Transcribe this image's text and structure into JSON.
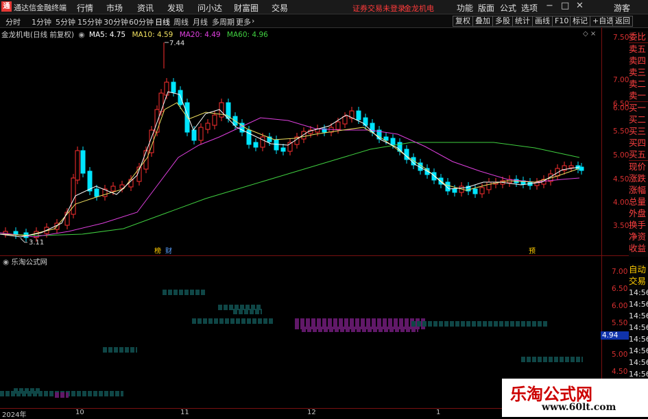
{
  "title_bar": {
    "app_title": "通达信金融终端",
    "menu": [
      "行情",
      "市场",
      "资讯",
      "发现",
      "问小达",
      "财富圈",
      "交易"
    ],
    "warning": "证券交易未登录",
    "stock_name": "金龙机电",
    "right_menu": [
      "功能",
      "版面",
      "公式",
      "选项"
    ],
    "guest": "游客"
  },
  "toolbar": {
    "periods": [
      "分时",
      "1分钟",
      "5分钟",
      "15分钟",
      "30分钟",
      "60分钟",
      "日线",
      "周线",
      "月线",
      "多周期",
      "更多"
    ],
    "active_period": "日线",
    "right_buttons": [
      "复权",
      "叠加",
      "多股",
      "统计",
      "画线",
      "F10",
      "标记",
      "+自选",
      "返回"
    ]
  },
  "main_chart": {
    "stock_label": "金龙机电(日线 前复权)",
    "ma": [
      {
        "name": "MA5",
        "value": "4.75",
        "color": "#ffffff"
      },
      {
        "name": "MA10",
        "value": "4.59",
        "color": "#f0e060"
      },
      {
        "name": "MA20",
        "value": "4.49",
        "color": "#e040e0"
      },
      {
        "name": "MA60",
        "value": "4.96",
        "color": "#40d040"
      }
    ],
    "high_label": "7.44",
    "low_label": "3.11",
    "y_ticks": [
      "7.50",
      "7.00",
      "6.50",
      "6.00",
      "5.50",
      "5.00",
      "4.50",
      "4.00",
      "3.50"
    ],
    "events": [
      {
        "text": "榜",
        "color": "#ffcc00"
      },
      {
        "text": "财",
        "color": "#5aa0ff"
      },
      {
        "text": "预",
        "color": "#ffcc00"
      }
    ]
  },
  "sub_chart": {
    "title": "乐淘公式网",
    "y_ticks": [
      "7.00",
      "6.50",
      "6.00",
      "5.50",
      "5.00",
      "4.50"
    ],
    "current_value": "4.94"
  },
  "x_axis": [
    "2024年",
    "10",
    "11",
    "12",
    "1"
  ],
  "right_panel": {
    "quote_labels": [
      "委比",
      "卖五",
      "卖四",
      "卖三",
      "卖二",
      "卖一",
      "买一",
      "买二",
      "买三",
      "买四",
      "买五",
      "现价",
      "涨跌",
      "涨幅",
      "总量",
      "外盘",
      "换手",
      "净资",
      "收益"
    ],
    "ticks_title": [
      "自动",
      "交易"
    ],
    "tick_times": [
      "14:56",
      "14:56",
      "14:56",
      "14:56",
      "14:56",
      "14:56",
      "14:56",
      "14:56",
      "14:56"
    ]
  },
  "watermark": {
    "brand": "乐淘公式网",
    "url": "www.60lt.com"
  },
  "colors": {
    "up": "#ff3030",
    "down": "#00e5ff",
    "axis": "#7a1010",
    "grid_dot": "#6a1010"
  }
}
